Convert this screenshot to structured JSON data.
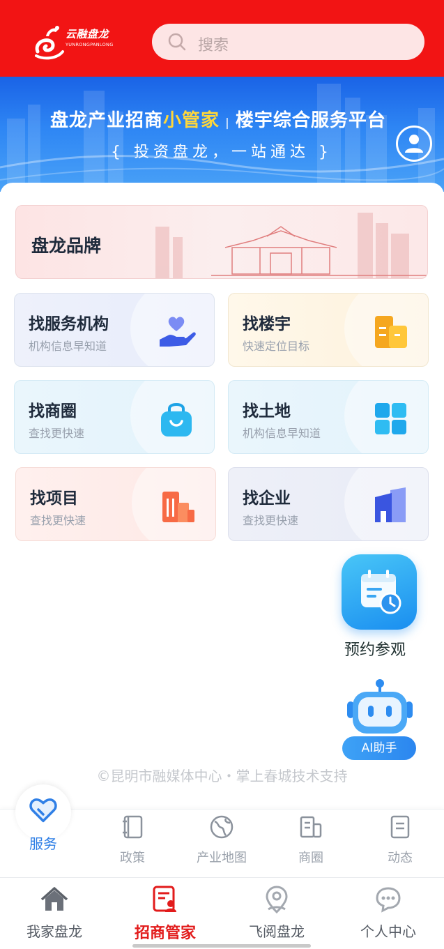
{
  "header": {
    "logo_text": "云融盘龙",
    "logo_sub": "YUNRONGPANLONG",
    "search_placeholder": "搜索"
  },
  "banner": {
    "title_a": "盘龙产业招商",
    "title_highlight": "小管家",
    "title_sep": "|",
    "title_b": "楼宇综合服务平台",
    "subtitle": "{ 投资盘龙，一站通达 }"
  },
  "brand": {
    "label": "盘龙品牌"
  },
  "services": [
    {
      "title": "找服务机构",
      "subtitle": "机构信息早知道",
      "icon": "heart-hand-icon"
    },
    {
      "title": "找楼宇",
      "subtitle": "快速定位目标",
      "icon": "building-icon"
    },
    {
      "title": "找商圈",
      "subtitle": "查找更快速",
      "icon": "shopping-bag-icon"
    },
    {
      "title": "找土地",
      "subtitle": "机构信息早知道",
      "icon": "grid-land-icon"
    },
    {
      "title": "找项目",
      "subtitle": "查找更快速",
      "icon": "project-building-icon"
    },
    {
      "title": "找企业",
      "subtitle": "查找更快速",
      "icon": "enterprise-building-icon"
    }
  ],
  "floating": {
    "visit_label": "预约参观",
    "ai_label": "AI助手"
  },
  "footer": {
    "copyright": "©昆明市融媒体中心・掌上春城技术支持"
  },
  "subnav": [
    {
      "label": "服务",
      "active": true
    },
    {
      "label": "政策"
    },
    {
      "label": "产业地图"
    },
    {
      "label": "商圈"
    },
    {
      "label": "动态"
    }
  ],
  "tabbar": [
    {
      "label": "我家盘龙"
    },
    {
      "label": "招商管家",
      "active": true
    },
    {
      "label": "飞阅盘龙"
    },
    {
      "label": "个人中心"
    }
  ],
  "colors": {
    "header_red": "#f21414",
    "active_tab_red": "#e21b1b",
    "active_subnav_blue": "#2f7fe6",
    "banner_blue": "#2e86f4"
  }
}
